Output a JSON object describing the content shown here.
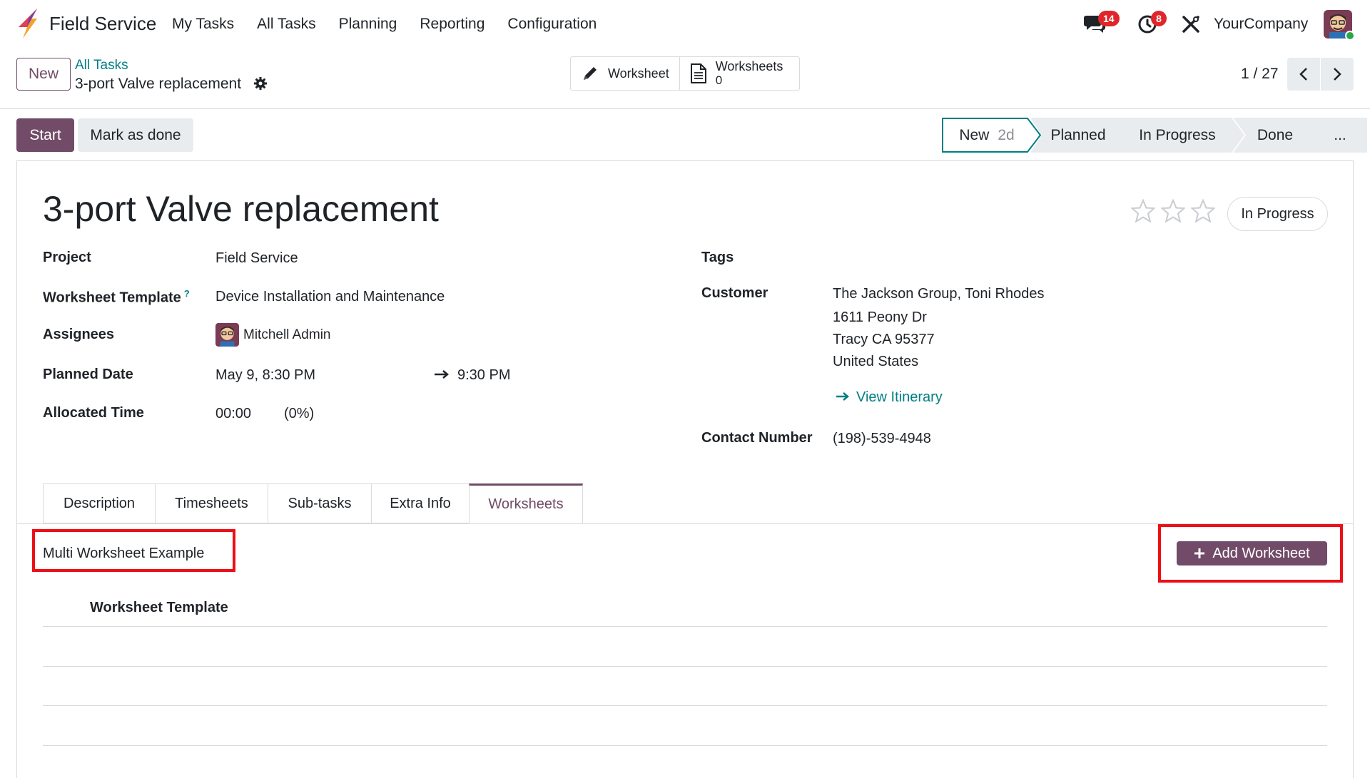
{
  "navbar": {
    "app_name": "Field Service",
    "menu": [
      "My Tasks",
      "All Tasks",
      "Planning",
      "Reporting",
      "Configuration"
    ],
    "messages_count": "14",
    "activities_count": "8",
    "company": "YourCompany"
  },
  "control_panel": {
    "new_label": "New",
    "breadcrumb_parent": "All Tasks",
    "breadcrumb_current": "3-port Valve replacement",
    "smart_buttons": {
      "worksheet_label": "Worksheet",
      "worksheets_label": "Worksheets",
      "worksheets_count": "0"
    },
    "pager": "1 / 27"
  },
  "statusbar": {
    "start_label": "Start",
    "mark_done_label": "Mark as done",
    "stages": [
      {
        "label": "New",
        "duration": "2d"
      },
      {
        "label": "Planned"
      },
      {
        "label": "In Progress"
      },
      {
        "label": "Done"
      },
      {
        "label": "..."
      }
    ],
    "current_stage": "New"
  },
  "form": {
    "title": "3-port Valve replacement",
    "priority_stars": {
      "filled": 0,
      "total": 3
    },
    "kanban_state": "In Progress",
    "fields_left": {
      "project_label": "Project",
      "project_value": "Field Service",
      "worksheet_template_label": "Worksheet Template",
      "worksheet_template_help": "?",
      "worksheet_template_value": "Device Installation and Maintenance",
      "assignees_label": "Assignees",
      "assignees_value": "Mitchell Admin",
      "planned_date_label": "Planned Date",
      "planned_date_start": "May 9, 8:30 PM",
      "planned_date_end": "9:30 PM",
      "allocated_time_label": "Allocated Time",
      "allocated_time_value": "00:00",
      "allocated_time_percent": "(0%)"
    },
    "fields_right": {
      "tags_label": "Tags",
      "customer_label": "Customer",
      "customer_name": "The Jackson Group, Toni Rhodes",
      "address_line1": "1611 Peony Dr",
      "address_line2": "Tracy CA 95377",
      "address_line3": "United States",
      "view_itinerary": "View Itinerary",
      "contact_label": "Contact Number",
      "contact_value": "(198)-539-4948"
    }
  },
  "notebook": {
    "tabs": [
      "Description",
      "Timesheets",
      "Sub-tasks",
      "Extra Info",
      "Worksheets"
    ],
    "active_tab": "Worksheets",
    "worksheets": {
      "section_label": "Multi Worksheet Example",
      "add_button": "Add Worksheet",
      "column_header": "Worksheet Template"
    }
  },
  "colors": {
    "primary": "#714b67",
    "link": "#017e84",
    "badge": "#e0262b",
    "highlight": "#ec0f17"
  }
}
